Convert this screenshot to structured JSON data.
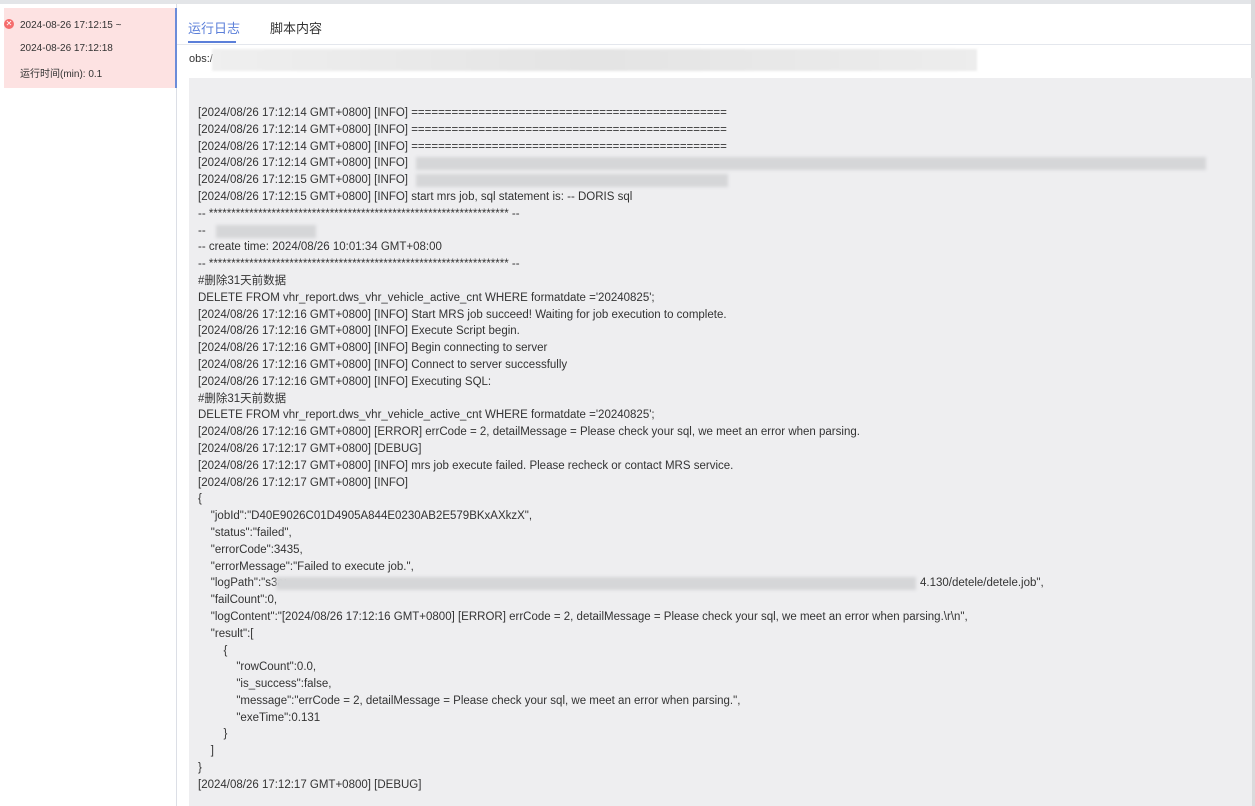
{
  "run_list": [
    {
      "status": "failed",
      "start_time": "2024-08-26 17:12:15 ~",
      "end_time": "2024-08-26 17:12:18",
      "duration": "运行时间(min): 0.1",
      "status_icon": "error-circle-icon"
    }
  ],
  "tabs": [
    {
      "label": "运行日志",
      "active": true
    },
    {
      "label": "脚本内容",
      "active": false
    }
  ],
  "obs_label": "obs:/",
  "log_lines": [
    "[2024/08/26 17:12:14 GMT+0800] [INFO] ===============================================",
    "[2024/08/26 17:12:14 GMT+0800] [INFO] ===============================================",
    "[2024/08/26 17:12:14 GMT+0800] [INFO] ===============================================",
    "[2024/08/26 17:12:14 GMT+0800] [INFO]",
    "[2024/08/26 17:12:15 GMT+0800] [INFO]",
    "[2024/08/26 17:12:15 GMT+0800] [INFO] start mrs job, sql statement is: -- DORIS sql",
    "-- ******************************************************************* --",
    "--",
    "-- create time: 2024/08/26 10:01:34 GMT+08:00",
    "-- ******************************************************************* --",
    "#删除31天前数据",
    "DELETE FROM vhr_report.dws_vhr_vehicle_active_cnt WHERE formatdate ='20240825';",
    "[2024/08/26 17:12:16 GMT+0800] [INFO] Start MRS job succeed! Waiting for job execution to complete.",
    "[2024/08/26 17:12:16 GMT+0800] [INFO] Execute Script begin.",
    "[2024/08/26 17:12:16 GMT+0800] [INFO] Begin connecting to server",
    "[2024/08/26 17:12:16 GMT+0800] [INFO] Connect to server successfully",
    "[2024/08/26 17:12:16 GMT+0800] [INFO] Executing SQL:",
    "#删除31天前数据",
    "DELETE FROM vhr_report.dws_vhr_vehicle_active_cnt WHERE formatdate ='20240825';",
    "[2024/08/26 17:12:16 GMT+0800] [ERROR] errCode = 2, detailMessage = Please check your sql, we meet an error when parsing.",
    "[2024/08/26 17:12:17 GMT+0800] [DEBUG]",
    "[2024/08/26 17:12:17 GMT+0800] [INFO] mrs job execute failed. Please recheck or contact MRS service.",
    "[2024/08/26 17:12:17 GMT+0800] [INFO]",
    "{",
    "    \"jobId\":\"D40E9026C01D4905A844E0230AB2E579BKxAXkzX\",",
    "    \"status\":\"failed\",",
    "    \"errorCode\":3435,",
    "    \"errorMessage\":\"Failed to execute job.\",",
    "    \"logPath\":\"s3a:",
    "    \"failCount\":0,",
    "    \"logContent\":\"[2024/08/26 17:12:16 GMT+0800] [ERROR] errCode = 2, detailMessage = Please check your sql, we meet an error when parsing.\\r\\n\",",
    "    \"result\":[",
    "        {",
    "            \"rowCount\":0.0,",
    "            \"is_success\":false,",
    "            \"message\":\"errCode = 2, detailMessage = Please check your sql, we meet an error when parsing.\",",
    "            \"exeTime\":0.131",
    "        }",
    "    ]",
    "}",
    "[2024/08/26 17:12:17 GMT+0800] [DEBUG]"
  ],
  "log_path_tail": "4.130/detele/detele.job\","
}
